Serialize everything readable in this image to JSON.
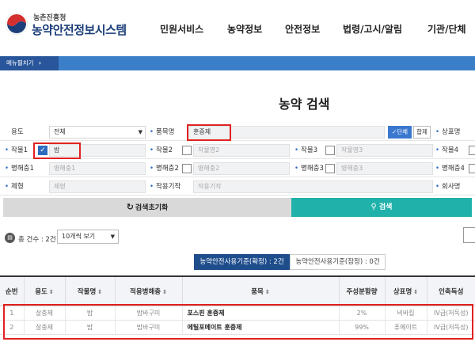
{
  "header": {
    "ministry": "농촌진흥청",
    "system_name": "농약안전정보시스템",
    "nav": [
      "민원서비스",
      "농약정보",
      "안전정보",
      "법령/고시/알림",
      "기관/단체"
    ]
  },
  "menu_toggle": "메뉴펼치기",
  "page_title": "농약 검색",
  "search": {
    "row1": {
      "use_label": "용도",
      "use_value": "전체",
      "product_label": "품목명",
      "product_value": "훈증제",
      "single_btn": "✓단체",
      "combined_btn": "합제",
      "brand_label": "상표명"
    },
    "row2": {
      "crop1_label": "작물1",
      "crop1_value": "밤",
      "crop2_label": "작물2",
      "crop2_placeholder": "작물명2",
      "crop3_label": "작물3",
      "crop3_placeholder": "작물명3",
      "crop4_label": "작물4"
    },
    "row3": {
      "pest1_label": "병해충1",
      "pest1_placeholder": "병해충1",
      "pest2_label": "병해충2",
      "pest2_placeholder": "병해충2",
      "pest3_label": "병해충3",
      "pest3_placeholder": "병해충3",
      "pest4_label": "병해충4"
    },
    "row4": {
      "form_label": "제형",
      "form_placeholder": "제형",
      "mechanism_label": "작용기작",
      "mechanism_placeholder": "작용기작",
      "company_label": "회사명"
    },
    "reset_label": "검색초기화",
    "search_label": "검색"
  },
  "results": {
    "count_text": "총 건수 : 2건",
    "view_option": "10개씩 보기",
    "tab_active": "농약안전사용기준(확정) : 2건",
    "tab_inactive": "농약안전사용기준(잠정) : 0건",
    "columns": [
      "순번",
      "용도",
      "작물명",
      "적용병해충",
      "품목",
      "주성분함량",
      "상표명",
      "인축독성"
    ],
    "rows": [
      [
        "1",
        "살충제",
        "밤",
        "밤바구미",
        "포스핀 훈증제",
        "2%",
        "비바킬",
        "IV급(저독성)"
      ],
      [
        "2",
        "살충제",
        "밤",
        "밤바구미",
        "에틸포메이트 훈증제",
        "99%",
        "퓨메이트",
        "IV급(저독성)"
      ]
    ]
  },
  "colors": {
    "brand_blue": "#1c3f7a",
    "menubar": "#3c7fc9",
    "search_teal": "#20b2aa",
    "tab_active": "#1e4d8c",
    "highlight": "#e02222"
  }
}
